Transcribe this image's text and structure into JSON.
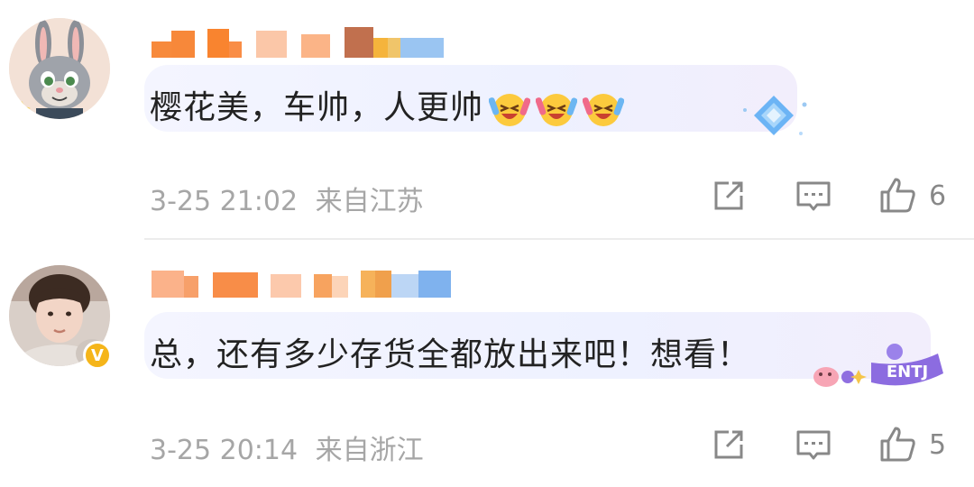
{
  "comments": [
    {
      "text": "樱花美，车帅，人更帅",
      "time": "3-25 21:02",
      "location": "来自江苏",
      "likes": "6",
      "emoji": "laughing-crying-emoji",
      "badge_icon": "diamond-badge-icon",
      "colors": {
        "name_blur": [
          "#f78a3c",
          "#f9a76a",
          "#fbd0b2",
          "#c46f4e",
          "#f5c24a",
          "#9bc6f2"
        ]
      }
    },
    {
      "text": "总，还有多少存货全都放出来吧！想看！",
      "time": "3-25 20:14",
      "location": "来自浙江",
      "likes": "5",
      "verified_badge": "V",
      "badge_icon": "entj-badge-icon",
      "badge_text": "ENTJ",
      "colors": {
        "name_blur": [
          "#fbb28a",
          "#f88d48",
          "#fcd1b8",
          "#f6b25a",
          "#f0a04c",
          "#bcd6f5",
          "#7fb2ee"
        ]
      }
    }
  ],
  "icons": {
    "share": "share-icon",
    "comment": "comment-icon",
    "like": "thumbs-up-icon"
  }
}
